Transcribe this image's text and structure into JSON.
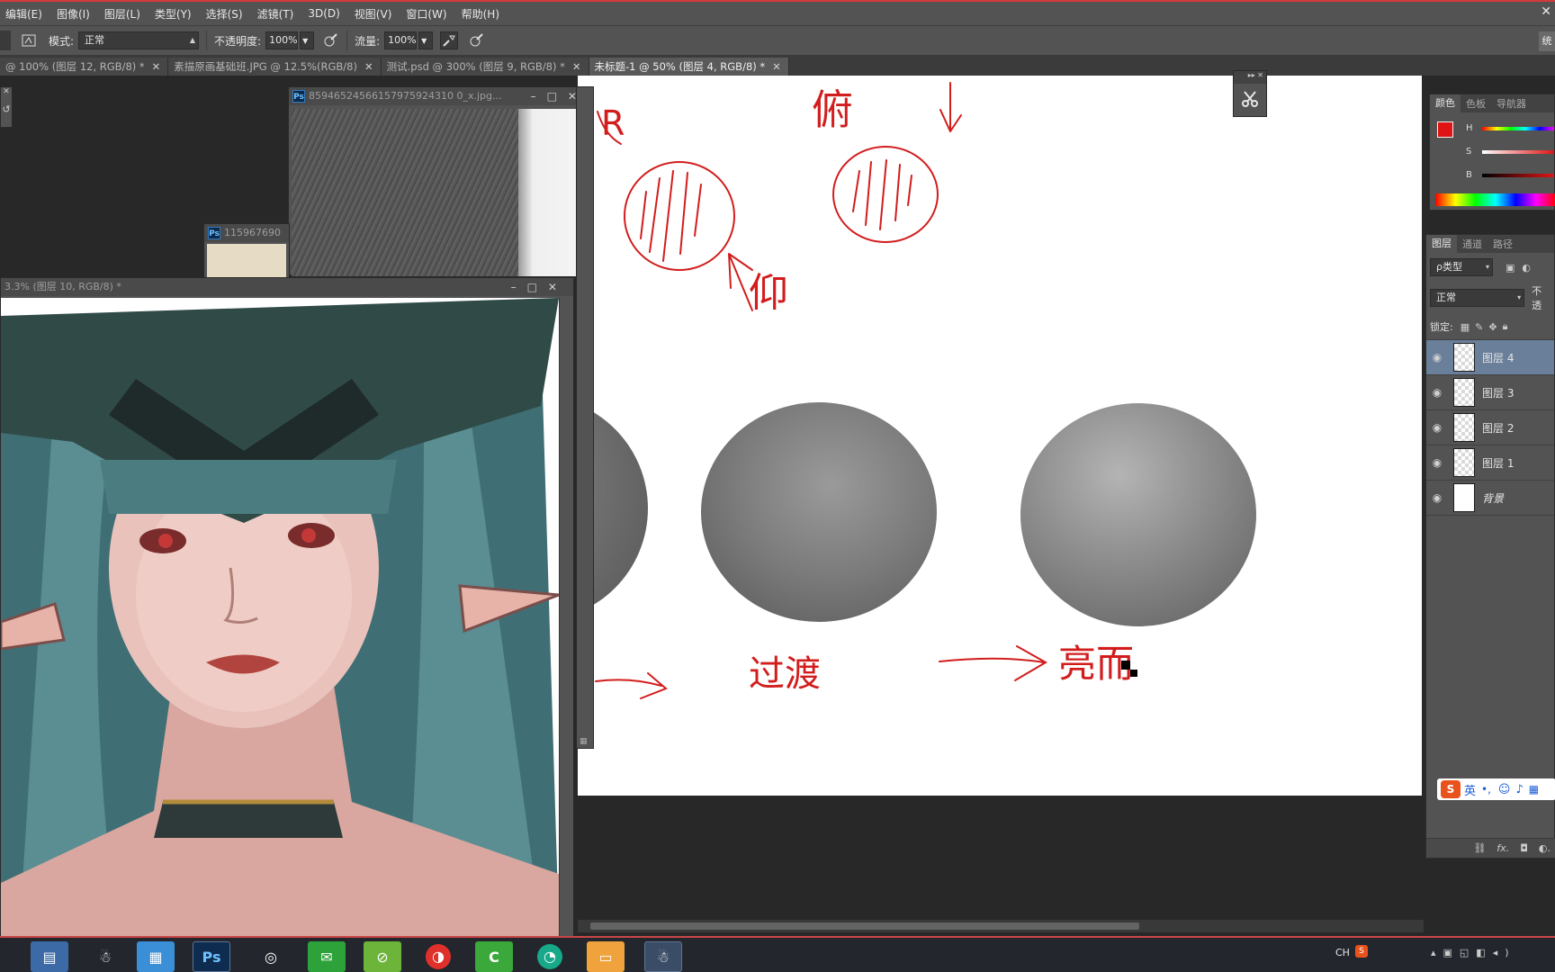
{
  "menubar": {
    "items": [
      "编辑(E)",
      "图像(I)",
      "图层(L)",
      "类型(Y)",
      "选择(S)",
      "滤镜(T)",
      "3D(D)",
      "视图(V)",
      "窗口(W)",
      "帮助(H)"
    ]
  },
  "options": {
    "mode_label": "模式:",
    "mode_value": "正常",
    "opacity_label": "不透明度:",
    "opacity_value": "100%",
    "flow_label": "流量:",
    "flow_value": "100%",
    "right_clip": "统"
  },
  "doc_tabs": [
    {
      "label": "@ 100% (图层 12, RGB/8) *",
      "active": false
    },
    {
      "label": "素描原画基础班.JPG @ 12.5%(RGB/8)",
      "active": false
    },
    {
      "label": "测试.psd @ 300% (图层 9, RGB/8) *",
      "active": false
    },
    {
      "label": "未标题-1 @ 50% (图层 4, RGB/8) *",
      "active": true
    }
  ],
  "float_windows": {
    "texture_title": "85946524566157975924310 0_x.jpg...",
    "paper_title": "115967690",
    "portrait_title": "3.3% (图层 10, RGB/8) *"
  },
  "canvas_annotations": {
    "top_left_fragment": "R",
    "looking_down": "俯",
    "looking_up": "仰",
    "transition": "过渡",
    "bright_face": "亮而"
  },
  "color_panel": {
    "tabs": [
      "颜色",
      "色板",
      "导航器"
    ],
    "sliders": [
      "H",
      "S",
      "B"
    ],
    "foreground_color": "#e01414"
  },
  "layers_panel": {
    "tabs": [
      "图层",
      "通道",
      "路径"
    ],
    "filter_label": "ρ类型",
    "blend_mode": "正常",
    "opacity_clip": "不透",
    "lock_label": "锁定:",
    "layers": [
      {
        "name": "图层 4",
        "selected": true,
        "white": false
      },
      {
        "name": "图层 3",
        "selected": false,
        "white": false
      },
      {
        "name": "图层 2",
        "selected": false,
        "white": false
      },
      {
        "name": "图层 1",
        "selected": false,
        "white": false
      },
      {
        "name": "背景",
        "selected": false,
        "white": true
      }
    ],
    "footer_icons": [
      "link-icon",
      "fx-icon",
      "mask-icon",
      "adjustment-icon"
    ]
  },
  "ime_bar": {
    "logo": "S",
    "lang": "英"
  },
  "taskbar": {
    "apps": [
      "file-explorer-icon",
      "qq-icon",
      "notepad-icon",
      "photoshop-icon",
      "browser-icon",
      "wechat-icon",
      "360-icon",
      "netease-music-icon",
      "camtasia-icon",
      "iqiyi-icon",
      "folder-icon",
      "qq-penguin-icon"
    ],
    "tray_text": "CH"
  }
}
